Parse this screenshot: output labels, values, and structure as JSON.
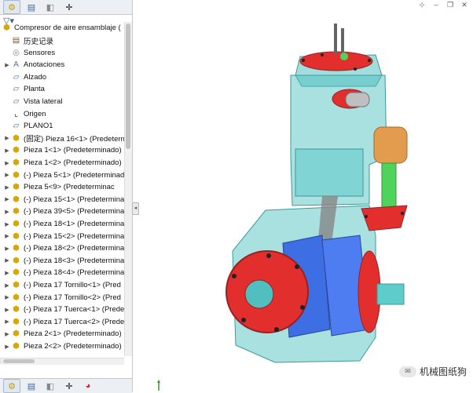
{
  "tree": {
    "root": "Compresor de aire ensamblaje  (",
    "items": [
      {
        "label": "历史记录",
        "icon": "history-icon",
        "arrow": ""
      },
      {
        "label": "Sensores",
        "icon": "sensor-icon",
        "arrow": ""
      },
      {
        "label": "Anotaciones",
        "icon": "annotation-icon",
        "arrow": "▶"
      },
      {
        "label": "Alzado",
        "icon": "plane-icon",
        "arrow": ""
      },
      {
        "label": "Planta",
        "icon": "plane-icon",
        "arrow": ""
      },
      {
        "label": "Vista lateral",
        "icon": "plane-icon",
        "arrow": ""
      },
      {
        "label": "Origen",
        "icon": "origin-icon",
        "arrow": ""
      },
      {
        "label": "PLANO1",
        "icon": "plane-icon",
        "arrow": ""
      },
      {
        "label": "(固定) Pieza 16<1> (Predetern",
        "icon": "part-icon",
        "arrow": "▶"
      },
      {
        "label": "Pieza 1<1> (Predeterminado)",
        "icon": "part-icon",
        "arrow": "▶"
      },
      {
        "label": "Pieza 1<2> (Predeterminado)",
        "icon": "part-icon",
        "arrow": "▶"
      },
      {
        "label": "(-) Pieza 5<1> (Predeterminad",
        "icon": "part-icon",
        "arrow": "▶"
      },
      {
        "label": "Pieza 5<9> (Predeterminac",
        "icon": "part-icon",
        "arrow": "▶"
      },
      {
        "label": "(-) Pieza 15<1> (Predetermina",
        "icon": "part-icon",
        "arrow": "▶"
      },
      {
        "label": "(-) Pieza 39<5> (Predetermina",
        "icon": "part-icon",
        "arrow": "▶"
      },
      {
        "label": "(-) Pieza 18<1> (Predetermina",
        "icon": "part-icon",
        "arrow": "▶"
      },
      {
        "label": "(-) Pieza 15<2> (Predetermina",
        "icon": "part-icon",
        "arrow": "▶"
      },
      {
        "label": "(-) Pieza 18<2> (Predetermina",
        "icon": "part-icon",
        "arrow": "▶"
      },
      {
        "label": "(-) Pieza 18<3> (Predetermina",
        "icon": "part-icon",
        "arrow": "▶"
      },
      {
        "label": "(-) Pieza 18<4> (Predetermina",
        "icon": "part-icon",
        "arrow": "▶"
      },
      {
        "label": "(-) Pieza 17 Tornillo<1> (Pred",
        "icon": "part-icon",
        "arrow": "▶"
      },
      {
        "label": "(-) Pieza 17 Tornillo<2> (Pred",
        "icon": "part-icon",
        "arrow": "▶"
      },
      {
        "label": "(-) Pieza 17 Tuerca<1> (Prede",
        "icon": "part-icon",
        "arrow": "▶"
      },
      {
        "label": "(-) Pieza 17 Tuerca<2> (Prede",
        "icon": "part-icon",
        "arrow": "▶"
      },
      {
        "label": "Pieza 2<1> (Predeterminado)",
        "icon": "part-icon",
        "arrow": "▶"
      },
      {
        "label": "Pieza 2<2> (Predeterminado)",
        "icon": "part-icon",
        "arrow": "▶"
      }
    ]
  },
  "watermark": {
    "text": "机械图纸狗"
  },
  "colors": {
    "body": "#3fb9b9",
    "flange": "#e01818",
    "crank": "#2a5fe0",
    "valve": "#e0913a",
    "arm": "#3dcf4a"
  }
}
